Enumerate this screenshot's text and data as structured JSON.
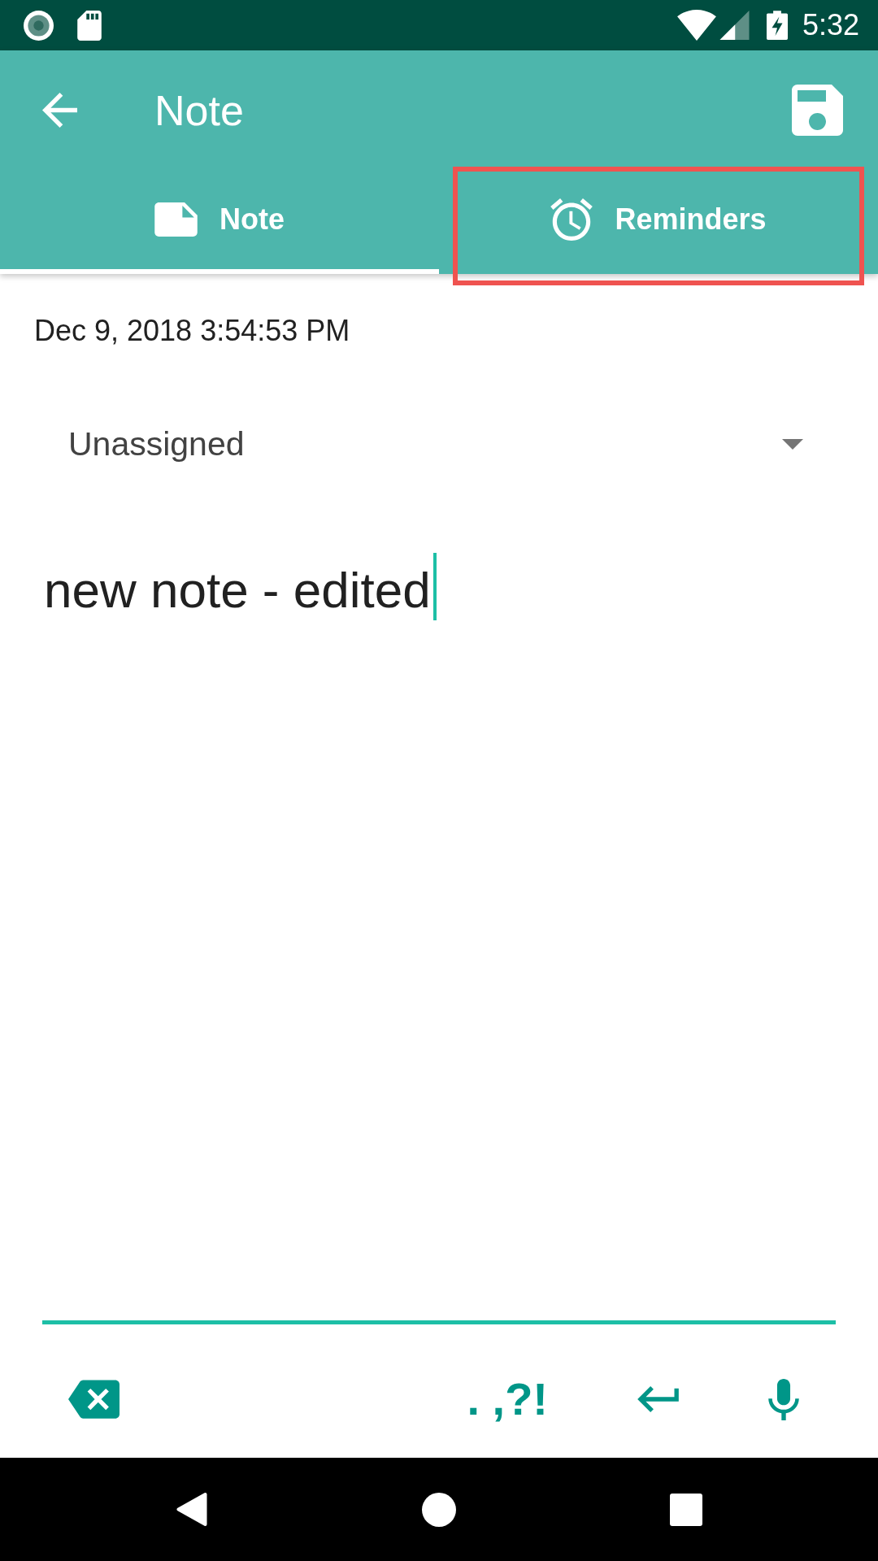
{
  "status_bar": {
    "time": "5:32"
  },
  "toolbar": {
    "title": "Note"
  },
  "tabs": [
    {
      "label": "Note",
      "selected": true,
      "highlighted": false
    },
    {
      "label": "Reminders",
      "selected": false,
      "highlighted": true
    }
  ],
  "note": {
    "timestamp": "Dec 9, 2018 3:54:53 PM",
    "category": "Unassigned",
    "body": {
      "value": "new note - edited",
      "focused": true
    }
  },
  "input_bar": [
    {
      "kind": "backspace"
    },
    {
      "kind": "punctuation",
      "label": ". ,?!"
    },
    {
      "kind": "enter"
    },
    {
      "kind": "voice"
    }
  ]
}
